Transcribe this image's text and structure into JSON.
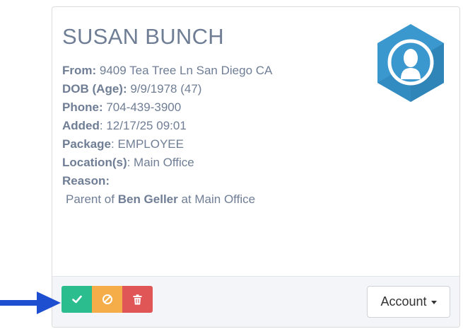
{
  "person": {
    "name": "SUSAN BUNCH",
    "from_label": "From:",
    "from_value": " 9409 Tea Tree Ln San Diego CA",
    "dob_label": "DOB (Age):",
    "dob_value": " 9/9/1978 (47)",
    "phone_label": "Phone:",
    "phone_value": " 704-439-3900",
    "added_label": "Added",
    "added_value": ": 12/17/25 09:01",
    "package_label": "Package",
    "package_value": ": EMPLOYEE",
    "location_label": "Location(s)",
    "location_value": ": Main Office",
    "reason_label": "Reason:",
    "reason_prefix": "Parent of ",
    "reason_child": "Ben Geller",
    "reason_suffix": " at Main Office"
  },
  "icons": {
    "avatar": "user-hexagon-icon",
    "approve": "check-icon",
    "deny": "ban-icon",
    "delete": "trash-icon",
    "pointer": "arrow-right-icon"
  },
  "footer": {
    "account_label": "Account"
  },
  "colors": {
    "text": "#6f7e95",
    "approve": "#2bbd8e",
    "deny": "#f4ad48",
    "delete": "#e05556",
    "avatar": "#3a98cf",
    "arrow": "#1f4fd1"
  }
}
